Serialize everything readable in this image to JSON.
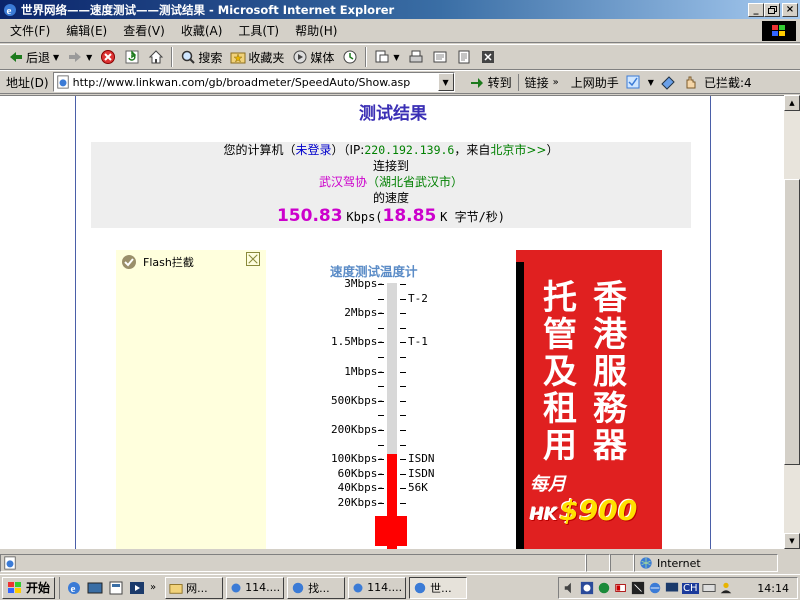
{
  "window": {
    "title": "世界网络——速度测试——测试结果 - Microsoft Internet Explorer",
    "buttons": {
      "minimize": "_",
      "maximize": "▫",
      "close": "×"
    }
  },
  "menu": [
    "文件(F)",
    "编辑(E)",
    "查看(V)",
    "收藏(A)",
    "工具(T)",
    "帮助(H)"
  ],
  "toolbar": {
    "back": "后退",
    "search": "搜索",
    "favorites": "收藏夹",
    "media": "媒体"
  },
  "address": {
    "label": "地址(D)",
    "url": "http://www.linkwan.com/gb/broadmeter/SpeedAuto/Show.asp",
    "go": "转到",
    "links": "链接",
    "assistant": "上网助手",
    "blocked": "已拦截:4"
  },
  "page": {
    "title": "测试结果",
    "line1_prefix": "您的计算机（",
    "not_logged_in": "未登录",
    "line1_mid": "）（IP:",
    "ip": "220.192.139.6",
    "line1_from": "，来自",
    "city": "北京市>>",
    "line1_end": "）",
    "connect_to": "连接到",
    "dest": "武汉驾协",
    "dest_loc": "（湖北省武汉市）",
    "speed_of": "的速度",
    "speed_kbps": "150.83",
    "unit_kbps": "Kbps(",
    "speed_kb": "18.85",
    "unit_kb": "K 字节/秒)",
    "flash_label": "Flash拦截",
    "thermo_title": "速度测试温度计",
    "thermo_labels": [
      {
        "label": "3Mbps-",
        "right": "",
        "level": 0
      },
      {
        "label": "",
        "right": "T-2",
        "level": 1
      },
      {
        "label": "2Mbps-",
        "right": "",
        "level": 2
      },
      {
        "label": "1.5Mbps-",
        "right": "T-1",
        "level": 4
      },
      {
        "label": "1Mbps-",
        "right": "",
        "level": 6
      },
      {
        "label": "500Kbps-",
        "right": "",
        "level": 8
      },
      {
        "label": "200Kbps-",
        "right": "",
        "level": 10
      },
      {
        "label": "100Kbps-",
        "right": "ISDN",
        "level": 12
      },
      {
        "label": "60Kbps-",
        "right": "ISDN",
        "level": 13
      },
      {
        "label": "40Kbps-",
        "right": "56K",
        "level": 14
      },
      {
        "label": "20Kbps-",
        "right": "",
        "level": 15
      }
    ],
    "thermo_fill_fraction": 0.29,
    "ad": {
      "col_right": "香港服務器",
      "col_left": "托管及租用",
      "month": "每月",
      "hk": "HK",
      "price": "$900",
      "bg": "#e02020"
    }
  },
  "status": {
    "zone": "Internet"
  },
  "taskbar": {
    "start": "开始",
    "tasks": [
      "网...",
      "114....",
      "找...",
      "114....",
      "世..."
    ],
    "clock": "14:14",
    "ime": "CH"
  }
}
